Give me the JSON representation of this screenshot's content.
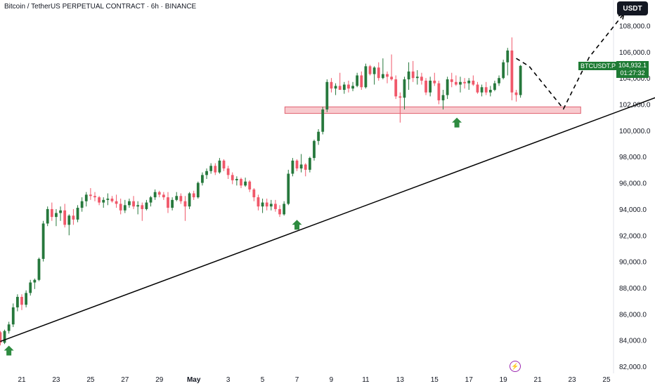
{
  "header": {
    "title": "Bitcoin / TetherUS PERPETUAL CONTRACT · 6h · BINANCE",
    "currency_label": "USDT"
  },
  "last_price": {
    "symbol": "BTCUSDT.P",
    "price": "104,932.1",
    "countdown": "01:27:32"
  },
  "colors": {
    "up": "#26783c",
    "down": "#f0586a",
    "trendline": "#000000",
    "zone": "#f4a6ae",
    "arrow": "#2e8b40"
  },
  "chart_data": {
    "type": "candlestick",
    "interval": "6h",
    "ylim": [
      81500,
      110000
    ],
    "y_ticks": [
      "108,000.0",
      "106,000.0",
      "104,000.0",
      "102,000.0",
      "100,000.0",
      "98,000.0",
      "96,000.0",
      "94,000.0",
      "92,000.0",
      "90,000.0",
      "88,000.0",
      "86,000.0",
      "84,000.0",
      "82,000.0"
    ],
    "y_tick_values": [
      108000,
      106000,
      104000,
      102000,
      100000,
      98000,
      96000,
      94000,
      92000,
      90000,
      88000,
      86000,
      84000,
      82000
    ],
    "x_ticks": [
      "21",
      "23",
      "25",
      "27",
      "29",
      "May",
      "3",
      "5",
      "7",
      "9",
      "11",
      "13",
      "15",
      "17",
      "19",
      "21",
      "23",
      "25"
    ],
    "x_tick_days": [
      0,
      2,
      4,
      6,
      8,
      10,
      12,
      14,
      16,
      18,
      20,
      22,
      24,
      26,
      28,
      30,
      32,
      34
    ],
    "candles": [
      [
        84900,
        85100,
        84300,
        84600
      ],
      [
        84600,
        84700,
        83600,
        83800
      ],
      [
        83800,
        84800,
        83700,
        84700
      ],
      [
        84700,
        85400,
        84500,
        85200
      ],
      [
        85200,
        86800,
        85000,
        86500
      ],
      [
        86500,
        87500,
        86200,
        87300
      ],
      [
        87300,
        87500,
        86300,
        86700
      ],
      [
        86700,
        87800,
        86500,
        87600
      ],
      [
        87600,
        88600,
        87400,
        88400
      ],
      [
        88400,
        88700,
        87900,
        88600
      ],
      [
        88600,
        90300,
        88500,
        90200
      ],
      [
        90200,
        93100,
        90000,
        92900
      ],
      [
        92900,
        94200,
        92700,
        94000
      ],
      [
        94000,
        94500,
        93100,
        93400
      ],
      [
        93400,
        94000,
        92700,
        93700
      ],
      [
        93700,
        94200,
        93100,
        93900
      ],
      [
        93900,
        94400,
        92600,
        92800
      ],
      [
        92800,
        93600,
        92000,
        93500
      ],
      [
        93500,
        94000,
        92800,
        93200
      ],
      [
        93200,
        94300,
        93000,
        94100
      ],
      [
        94100,
        94900,
        93800,
        94600
      ],
      [
        94600,
        95300,
        94200,
        95100
      ],
      [
        95100,
        95600,
        94700,
        95000
      ],
      [
        95000,
        95300,
        94600,
        94900
      ],
      [
        94900,
        95000,
        94300,
        94500
      ],
      [
        94500,
        94900,
        94100,
        94700
      ],
      [
        94700,
        95200,
        94300,
        94800
      ],
      [
        94800,
        95000,
        94500,
        94600
      ],
      [
        94600,
        95100,
        94100,
        94400
      ],
      [
        94400,
        94800,
        93600,
        93900
      ],
      [
        93900,
        94700,
        93700,
        94300
      ],
      [
        94300,
        94800,
        94100,
        94600
      ],
      [
        94600,
        95000,
        94000,
        94200
      ],
      [
        94200,
        94600,
        93600,
        94300
      ],
      [
        94300,
        94500,
        93100,
        94000
      ],
      [
        94000,
        94700,
        93900,
        94500
      ],
      [
        94500,
        95000,
        94200,
        94900
      ],
      [
        94900,
        95500,
        94700,
        95300
      ],
      [
        95300,
        95400,
        94900,
        95100
      ],
      [
        95100,
        95300,
        94700,
        94900
      ],
      [
        94900,
        95300,
        93700,
        94100
      ],
      [
        94100,
        94900,
        93900,
        94700
      ],
      [
        94700,
        95300,
        94600,
        95000
      ],
      [
        95000,
        95200,
        94400,
        94600
      ],
      [
        94600,
        95000,
        93100,
        94200
      ],
      [
        94200,
        95300,
        94000,
        95200
      ],
      [
        95200,
        95400,
        94700,
        94900
      ],
      [
        94900,
        96100,
        94800,
        96000
      ],
      [
        96000,
        96800,
        95800,
        96600
      ],
      [
        96600,
        97100,
        96300,
        96900
      ],
      [
        96900,
        97500,
        96700,
        97300
      ],
      [
        97300,
        97500,
        96600,
        96800
      ],
      [
        96800,
        97900,
        96700,
        97700
      ],
      [
        97700,
        97800,
        96900,
        97100
      ],
      [
        97100,
        97300,
        96300,
        96600
      ],
      [
        96600,
        96800,
        95900,
        96200
      ],
      [
        96200,
        96500,
        95800,
        96300
      ],
      [
        96300,
        96400,
        95600,
        95800
      ],
      [
        95800,
        96400,
        95700,
        96100
      ],
      [
        96100,
        96200,
        95300,
        95500
      ],
      [
        95500,
        95600,
        94600,
        94900
      ],
      [
        94900,
        95100,
        93900,
        94200
      ],
      [
        94200,
        94800,
        93700,
        94500
      ],
      [
        94500,
        94800,
        93900,
        94200
      ],
      [
        94200,
        94700,
        93900,
        94400
      ],
      [
        94400,
        94700,
        93800,
        94000
      ],
      [
        94000,
        94300,
        93400,
        93600
      ],
      [
        93600,
        94600,
        93500,
        94400
      ],
      [
        94400,
        97000,
        94300,
        96700
      ],
      [
        96700,
        97900,
        96500,
        97700
      ],
      [
        97700,
        97800,
        96900,
        97100
      ],
      [
        97100,
        98200,
        96800,
        97400
      ],
      [
        97400,
        97500,
        96500,
        97000
      ],
      [
        97000,
        98000,
        96800,
        97900
      ],
      [
        97900,
        99300,
        97700,
        99200
      ],
      [
        99200,
        100100,
        98900,
        99900
      ],
      [
        99900,
        101800,
        99700,
        101600
      ],
      [
        101600,
        103900,
        101400,
        103700
      ],
      [
        103700,
        104000,
        102900,
        103200
      ],
      [
        103200,
        103600,
        102700,
        103400
      ],
      [
        103400,
        104400,
        103100,
        103100
      ],
      [
        103100,
        103700,
        102800,
        103500
      ],
      [
        103500,
        103800,
        102900,
        103200
      ],
      [
        103200,
        103700,
        103000,
        103400
      ],
      [
        103400,
        104400,
        103300,
        104200
      ],
      [
        104200,
        104500,
        103100,
        103300
      ],
      [
        103300,
        105100,
        103200,
        104900
      ],
      [
        104900,
        105000,
        104200,
        104300
      ],
      [
        104300,
        104900,
        103500,
        104800
      ],
      [
        104800,
        105200,
        103800,
        104000
      ],
      [
        104000,
        105500,
        103900,
        104300
      ],
      [
        104300,
        104500,
        103600,
        104100
      ],
      [
        104100,
        105800,
        103800,
        103900
      ],
      [
        103900,
        104200,
        102400,
        102600
      ],
      [
        102600,
        102900,
        100600,
        102500
      ],
      [
        102500,
        104100,
        101600,
        103900
      ],
      [
        103900,
        105200,
        103100,
        104500
      ],
      [
        104500,
        105300,
        103700,
        104000
      ],
      [
        104000,
        104600,
        103500,
        104100
      ],
      [
        104100,
        104400,
        103500,
        103800
      ],
      [
        103800,
        104000,
        102700,
        102900
      ],
      [
        102900,
        104100,
        102600,
        103800
      ],
      [
        103800,
        104400,
        103400,
        103600
      ],
      [
        103600,
        103800,
        102000,
        102300
      ],
      [
        102300,
        103100,
        101600,
        102700
      ],
      [
        102700,
        104100,
        102400,
        103900
      ],
      [
        103900,
        104400,
        103300,
        103700
      ],
      [
        103700,
        104200,
        103400,
        103500
      ],
      [
        103500,
        104100,
        102900,
        103700
      ],
      [
        103700,
        104000,
        103200,
        103600
      ],
      [
        103600,
        104000,
        103100,
        103800
      ],
      [
        103800,
        104200,
        103400,
        103500
      ],
      [
        103500,
        103700,
        102800,
        102900
      ],
      [
        102900,
        103500,
        102600,
        103300
      ],
      [
        103300,
        103700,
        102700,
        102900
      ],
      [
        102900,
        103400,
        102600,
        103100
      ],
      [
        103100,
        103800,
        103000,
        103600
      ],
      [
        103600,
        104200,
        103400,
        104000
      ],
      [
        104000,
        105400,
        103900,
        105200
      ],
      [
        105200,
        106300,
        104200,
        106100
      ],
      [
        106100,
        107100,
        102300,
        102900
      ],
      [
        102900,
        103100,
        102200,
        102700
      ],
      [
        102700,
        105000,
        102500,
        104932
      ]
    ],
    "first_candle_day": -1.5,
    "candle_step_days": 0.25,
    "trendline": {
      "from": [
        -1.25,
        83900
      ],
      "to": [
        39.5,
        103800
      ]
    },
    "support_zone": {
      "x": [
        15.3,
        32.5
      ],
      "y": [
        101300,
        101800
      ]
    },
    "projection": [
      [
        28.75,
        105500
      ],
      [
        29.5,
        104900
      ],
      [
        31.5,
        101650
      ],
      [
        33,
        105600
      ],
      [
        35,
        108900
      ]
    ],
    "buy_arrows": [
      {
        "day": -0.75,
        "price": 83900
      },
      {
        "day": 16.0,
        "price": 93500
      },
      {
        "day": 25.3,
        "price": 101300
      }
    ]
  }
}
